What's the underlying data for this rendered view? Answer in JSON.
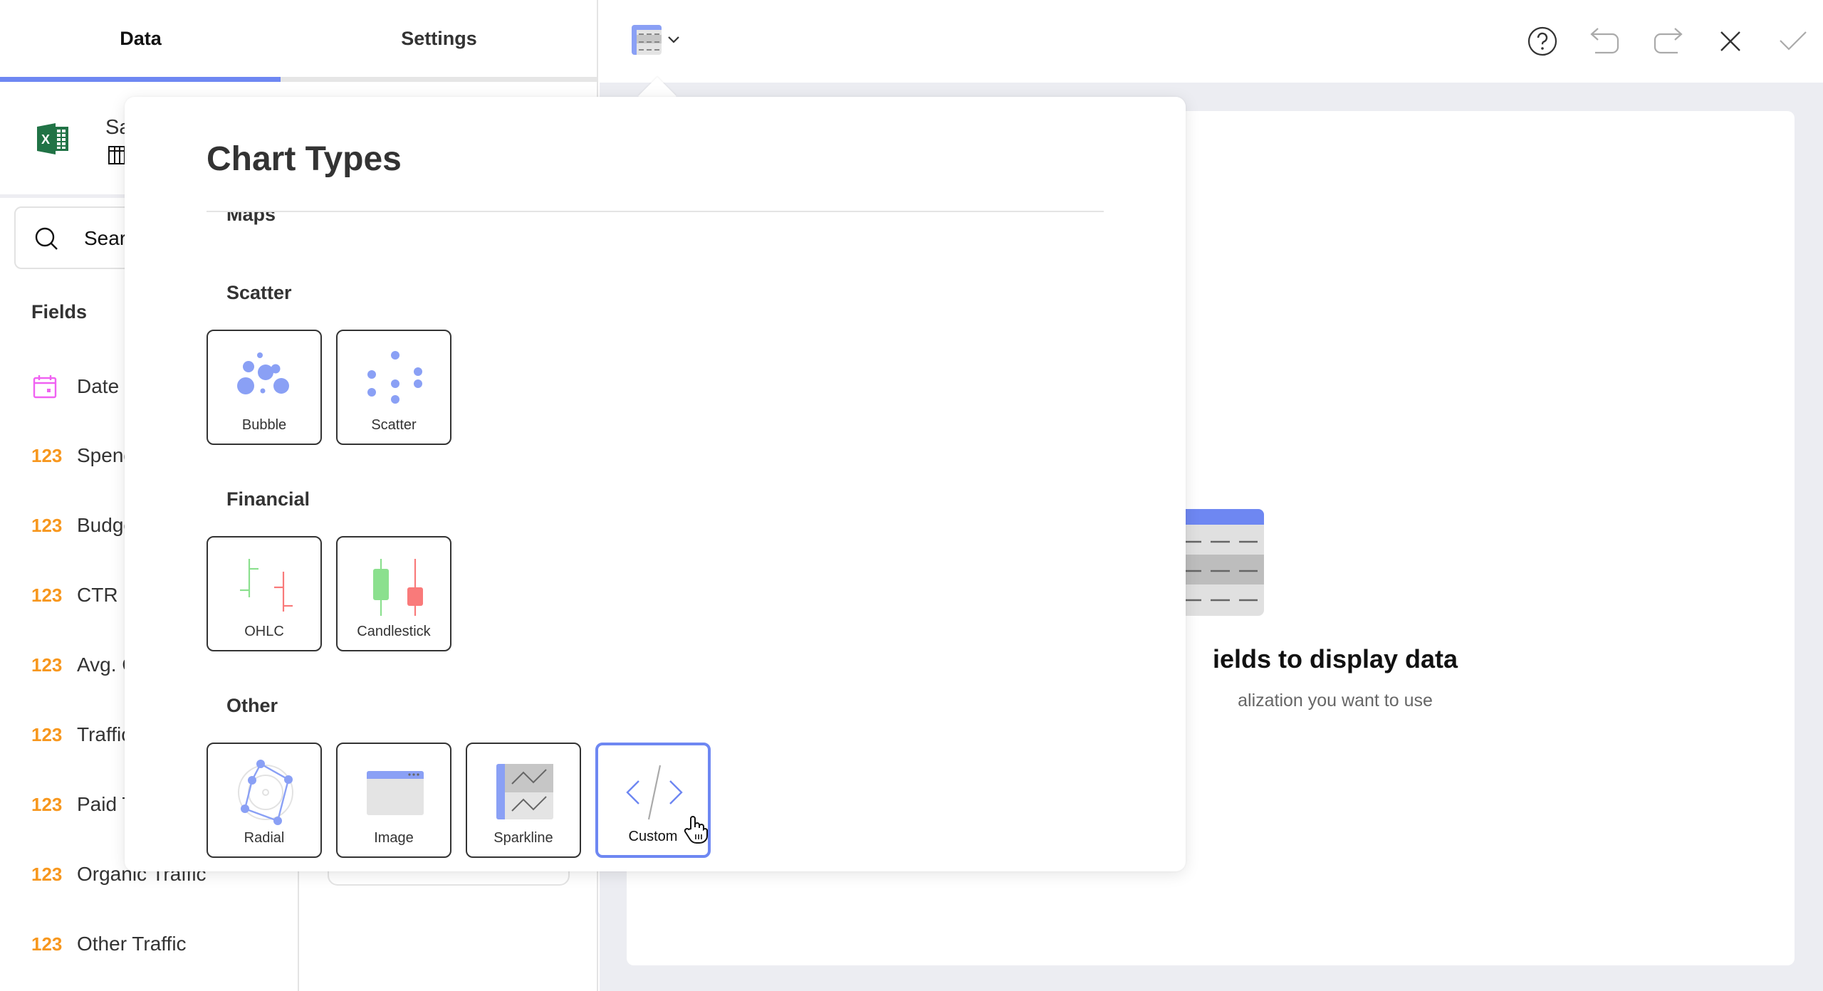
{
  "tabs": [
    {
      "label": "Data",
      "active": true
    },
    {
      "label": "Settings",
      "active": false
    }
  ],
  "data_source": {
    "name_visible": "Sa",
    "icon": "excel-icon"
  },
  "search": {
    "text_visible": "Sear",
    "icon": "search-icon"
  },
  "fields": {
    "title": "Fields",
    "items": [
      {
        "type": "date",
        "type_label": "",
        "name": "Date"
      },
      {
        "type": "number",
        "type_label": "123",
        "name": "Spend"
      },
      {
        "type": "number",
        "type_label": "123",
        "name": "Budget"
      },
      {
        "type": "number",
        "type_label": "123",
        "name": "CTR"
      },
      {
        "type": "number",
        "type_label": "123",
        "name": "Avg. C"
      },
      {
        "type": "number",
        "type_label": "123",
        "name": "Traffic"
      },
      {
        "type": "number",
        "type_label": "123",
        "name": "Paid T"
      },
      {
        "type": "number",
        "type_label": "123",
        "name": "Organic Traffic"
      },
      {
        "type": "number",
        "type_label": "123",
        "name": "Other Traffic"
      }
    ]
  },
  "toolbar": {
    "viz_picker_icon": "grid-chart-icon",
    "buttons": [
      {
        "name": "help",
        "icon": "help-icon",
        "enabled": true
      },
      {
        "name": "undo",
        "icon": "undo-icon",
        "enabled": false
      },
      {
        "name": "redo",
        "icon": "redo-icon",
        "enabled": false
      },
      {
        "name": "close",
        "icon": "close-icon",
        "enabled": true
      },
      {
        "name": "apply",
        "icon": "check-icon",
        "enabled": false
      }
    ]
  },
  "empty_state": {
    "title_visible": "ields to display data",
    "subtitle_visible": "alization you want to use"
  },
  "chart_types": {
    "title": "Chart Types",
    "partial_section": "Maps",
    "sections": [
      {
        "title": "Scatter",
        "items": [
          {
            "label": "Bubble",
            "icon": "bubble-chart-icon",
            "selected": false
          },
          {
            "label": "Scatter",
            "icon": "scatter-chart-icon",
            "selected": false
          }
        ]
      },
      {
        "title": "Financial",
        "items": [
          {
            "label": "OHLC",
            "icon": "ohlc-chart-icon",
            "selected": false
          },
          {
            "label": "Candlestick",
            "icon": "candlestick-chart-icon",
            "selected": false
          }
        ]
      },
      {
        "title": "Other",
        "items": [
          {
            "label": "Radial",
            "icon": "radial-chart-icon",
            "selected": false
          },
          {
            "label": "Image",
            "icon": "image-icon",
            "selected": false
          },
          {
            "label": "Sparkline",
            "icon": "sparkline-icon",
            "selected": false
          },
          {
            "label": "Custom",
            "icon": "code-icon",
            "selected": true
          }
        ]
      }
    ]
  },
  "colors": {
    "accent": "#6e87f2",
    "icon_blue": "#8aa0f5",
    "number_type": "#f7971e",
    "date_type": "#f062f2",
    "excel_green": "#217346",
    "candle_up": "#8be08e",
    "candle_down": "#f97a7a",
    "canvas_bg": "#ecedf2"
  }
}
